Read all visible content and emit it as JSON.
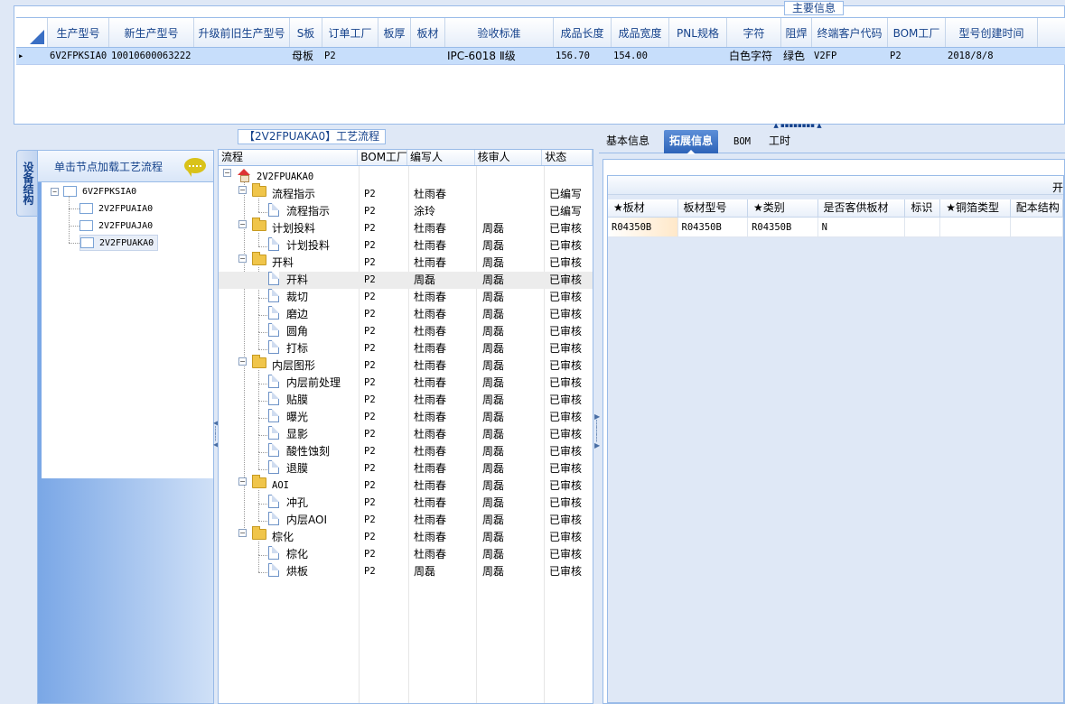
{
  "top": {
    "legend": "主要信息",
    "columns": [
      "生产型号",
      "新生产型号",
      "升级前旧生产型号",
      "S板",
      "订单工厂",
      "板厚",
      "板材",
      "验收标准",
      "成品长度",
      "成品宽度",
      "PNL规格",
      "字符",
      "阻焊",
      "终端客户代码",
      "BOM工厂",
      "型号创建时间"
    ],
    "row": {
      "arrow": "▸",
      "cells": [
        "6V2FPKSIA0",
        "10010600063222",
        "",
        "母板",
        "P2",
        "",
        "",
        "IPC-6018 Ⅱ级",
        "156.70",
        "154.00",
        "",
        "白色字符",
        "绿色",
        "V2FP",
        "P2",
        "2018/8/8"
      ]
    }
  },
  "side_tab": "设备结构",
  "structure": {
    "header": "单击节点加载工艺流程",
    "root": "6V2FPKSIA0",
    "children": [
      "2V2FPUAIA0",
      "2V2FPUAJA0",
      "2V2FPUAKA0"
    ]
  },
  "process": {
    "legend": "【2V2FPUAKA0】工艺流程",
    "columns": [
      "流程",
      "BOM工厂",
      "编写人",
      "核审人",
      "状态"
    ],
    "rows": [
      {
        "name": "2V2FPUAKA0",
        "level": 0,
        "type": "root",
        "bom": "",
        "writer": "",
        "reviewer": "",
        "status": ""
      },
      {
        "name": "流程指示",
        "level": 1,
        "type": "folder",
        "bom": "P2",
        "writer": "杜雨春",
        "reviewer": "",
        "status": "已编写"
      },
      {
        "name": "流程指示",
        "level": 2,
        "type": "doc",
        "bom": "P2",
        "writer": "涂玲",
        "reviewer": "",
        "status": "已编写"
      },
      {
        "name": "计划投料",
        "level": 1,
        "type": "folder",
        "bom": "P2",
        "writer": "杜雨春",
        "reviewer": "周磊",
        "status": "已审核"
      },
      {
        "name": "计划投料",
        "level": 2,
        "type": "doc",
        "bom": "P2",
        "writer": "杜雨春",
        "reviewer": "周磊",
        "status": "已审核"
      },
      {
        "name": "开料",
        "level": 1,
        "type": "folder",
        "bom": "P2",
        "writer": "杜雨春",
        "reviewer": "周磊",
        "status": "已审核"
      },
      {
        "name": "开料",
        "level": 2,
        "type": "doc",
        "bom": "P2",
        "writer": "周磊",
        "reviewer": "周磊",
        "status": "已审核",
        "selected": true
      },
      {
        "name": "裁切",
        "level": 2,
        "type": "doc",
        "bom": "P2",
        "writer": "杜雨春",
        "reviewer": "周磊",
        "status": "已审核"
      },
      {
        "name": "磨边",
        "level": 2,
        "type": "doc",
        "bom": "P2",
        "writer": "杜雨春",
        "reviewer": "周磊",
        "status": "已审核"
      },
      {
        "name": "圆角",
        "level": 2,
        "type": "doc",
        "bom": "P2",
        "writer": "杜雨春",
        "reviewer": "周磊",
        "status": "已审核"
      },
      {
        "name": "打标",
        "level": 2,
        "type": "doc",
        "bom": "P2",
        "writer": "杜雨春",
        "reviewer": "周磊",
        "status": "已审核"
      },
      {
        "name": "内层图形",
        "level": 1,
        "type": "folder",
        "bom": "P2",
        "writer": "杜雨春",
        "reviewer": "周磊",
        "status": "已审核"
      },
      {
        "name": "内层前处理",
        "level": 2,
        "type": "doc",
        "bom": "P2",
        "writer": "杜雨春",
        "reviewer": "周磊",
        "status": "已审核"
      },
      {
        "name": "贴膜",
        "level": 2,
        "type": "doc",
        "bom": "P2",
        "writer": "杜雨春",
        "reviewer": "周磊",
        "status": "已审核"
      },
      {
        "name": "曝光",
        "level": 2,
        "type": "doc",
        "bom": "P2",
        "writer": "杜雨春",
        "reviewer": "周磊",
        "status": "已审核"
      },
      {
        "name": "显影",
        "level": 2,
        "type": "doc",
        "bom": "P2",
        "writer": "杜雨春",
        "reviewer": "周磊",
        "status": "已审核"
      },
      {
        "name": "酸性蚀刻",
        "level": 2,
        "type": "doc",
        "bom": "P2",
        "writer": "杜雨春",
        "reviewer": "周磊",
        "status": "已审核"
      },
      {
        "name": "退膜",
        "level": 2,
        "type": "doc",
        "bom": "P2",
        "writer": "杜雨春",
        "reviewer": "周磊",
        "status": "已审核"
      },
      {
        "name": "AOI",
        "level": 1,
        "type": "folder",
        "bom": "P2",
        "writer": "杜雨春",
        "reviewer": "周磊",
        "status": "已审核"
      },
      {
        "name": "冲孔",
        "level": 2,
        "type": "doc",
        "bom": "P2",
        "writer": "杜雨春",
        "reviewer": "周磊",
        "status": "已审核"
      },
      {
        "name": "内层AOI",
        "level": 2,
        "type": "doc",
        "bom": "P2",
        "writer": "杜雨春",
        "reviewer": "周磊",
        "status": "已审核"
      },
      {
        "name": "棕化",
        "level": 1,
        "type": "folder",
        "bom": "P2",
        "writer": "杜雨春",
        "reviewer": "周磊",
        "status": "已审核"
      },
      {
        "name": "棕化",
        "level": 2,
        "type": "doc",
        "bom": "P2",
        "writer": "杜雨春",
        "reviewer": "周磊",
        "status": "已审核"
      },
      {
        "name": "烘板",
        "level": 2,
        "type": "doc",
        "bom": "P2",
        "writer": "周磊",
        "reviewer": "周磊",
        "status": "已审核"
      }
    ]
  },
  "tabs": {
    "items": [
      "基本信息",
      "拓展信息",
      "BOM",
      "工时"
    ],
    "active": "拓展信息"
  },
  "ext": {
    "strip_text": "开",
    "columns": [
      "★板材",
      "板材型号",
      "★类别",
      "是否客供板材",
      "标识",
      "★铜箔类型",
      "配本结构"
    ],
    "row": [
      "R04350B",
      "R04350B",
      "R04350B",
      "N",
      "",
      "",
      ""
    ]
  },
  "colors": {
    "panel_border": "#99bbe8",
    "header_text": "#15428b",
    "selected_row": "#c7defb",
    "active_tab": "#2d63b8"
  }
}
